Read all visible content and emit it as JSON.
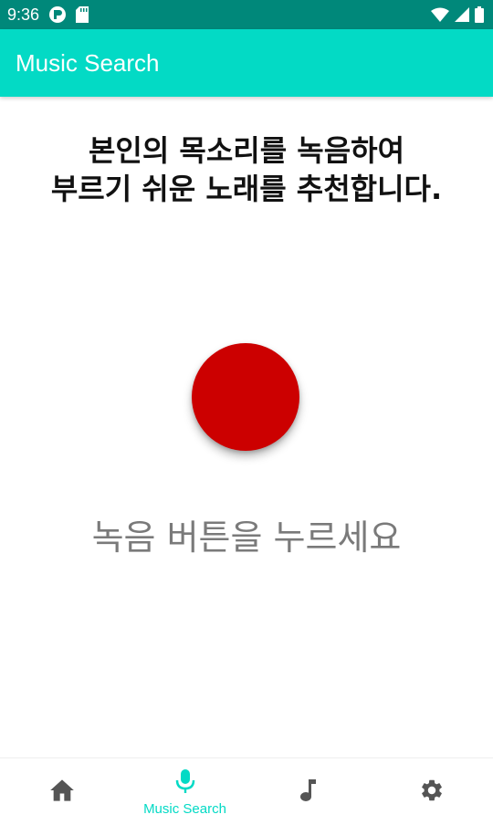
{
  "status_bar": {
    "time": "9:36",
    "icons": [
      "notification-app-icon",
      "sd-card-icon",
      "wifi-icon",
      "cell-signal-icon",
      "battery-icon"
    ]
  },
  "app_bar": {
    "title": "Music Search"
  },
  "main": {
    "headline_line1": "본인의 목소리를 녹음하여",
    "headline_line2": "부르기 쉬운 노래를 추천합니다.",
    "instruction": "녹음 버튼을 누르세요"
  },
  "bottom_nav": {
    "items": [
      {
        "icon": "home-icon",
        "label": ""
      },
      {
        "icon": "mic-icon",
        "label": "Music Search",
        "active": true
      },
      {
        "icon": "music-note-icon",
        "label": ""
      },
      {
        "icon": "gear-icon",
        "label": ""
      }
    ]
  },
  "colors": {
    "status_bar": "#00887a",
    "app_bar": "#03dac5",
    "record_button": "#cc0000",
    "active_nav": "#03dac5",
    "inactive_nav": "#555555"
  }
}
